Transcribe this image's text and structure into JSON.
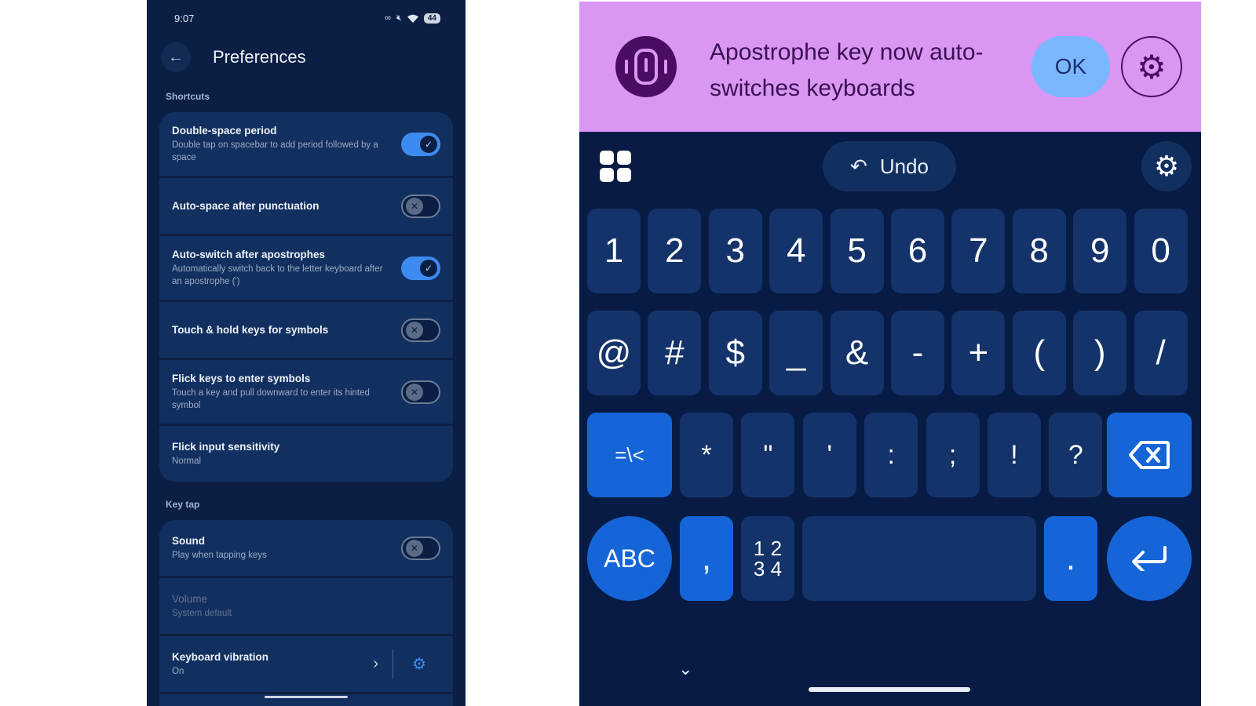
{
  "status": {
    "time": "9:07",
    "battery": "44"
  },
  "prefs": {
    "title": "Preferences",
    "sections": {
      "shortcuts": "Shortcuts",
      "key_tap": "Key tap"
    },
    "shortcuts": [
      {
        "title": "Double-space period",
        "subtitle": "Double tap on spacebar to add period followed by a space",
        "toggle": "on"
      },
      {
        "title": "Auto-space after punctuation",
        "subtitle": "",
        "toggle": "off"
      },
      {
        "title": "Auto-switch after apostrophes",
        "subtitle": "Automatically switch back to the letter keyboard after an apostrophe (')",
        "toggle": "on"
      },
      {
        "title": "Touch & hold keys for symbols",
        "subtitle": "",
        "toggle": "off"
      },
      {
        "title": "Flick keys to enter symbols",
        "subtitle": "Touch a key and pull downward to enter its hinted symbol",
        "toggle": "off"
      },
      {
        "title": "Flick input sensitivity",
        "subtitle": "Normal"
      }
    ],
    "key_tap": [
      {
        "title": "Sound",
        "subtitle": "Play when tapping keys",
        "toggle": "off"
      },
      {
        "title": "Volume",
        "subtitle": "System default"
      },
      {
        "title": "Keyboard vibration",
        "subtitle": "On"
      }
    ]
  },
  "keyboard": {
    "banner_text": "Apostrophe key now auto-switches keyboards",
    "banner_ok": "OK",
    "undo_label": "Undo",
    "row1": [
      "1",
      "2",
      "3",
      "4",
      "5",
      "6",
      "7",
      "8",
      "9",
      "0"
    ],
    "row2": [
      "@",
      "#",
      "$",
      "_",
      "&",
      "-",
      "+",
      "(",
      ")",
      "/"
    ],
    "row3": [
      "*",
      "\"",
      "'",
      ":",
      ";",
      "!",
      "?"
    ],
    "more_symbols": "=\\<",
    "abc": "ABC",
    "comma": ",",
    "numpad_top": "1 2",
    "numpad_bottom": "3 4",
    "period": ".",
    "icons": {
      "apps": "apps-grid-icon",
      "undo": "undo-arrow-icon",
      "settings": "gear-icon",
      "backspace": "backspace-icon",
      "enter": "enter-icon",
      "collapse": "chevron-down-icon"
    }
  }
}
